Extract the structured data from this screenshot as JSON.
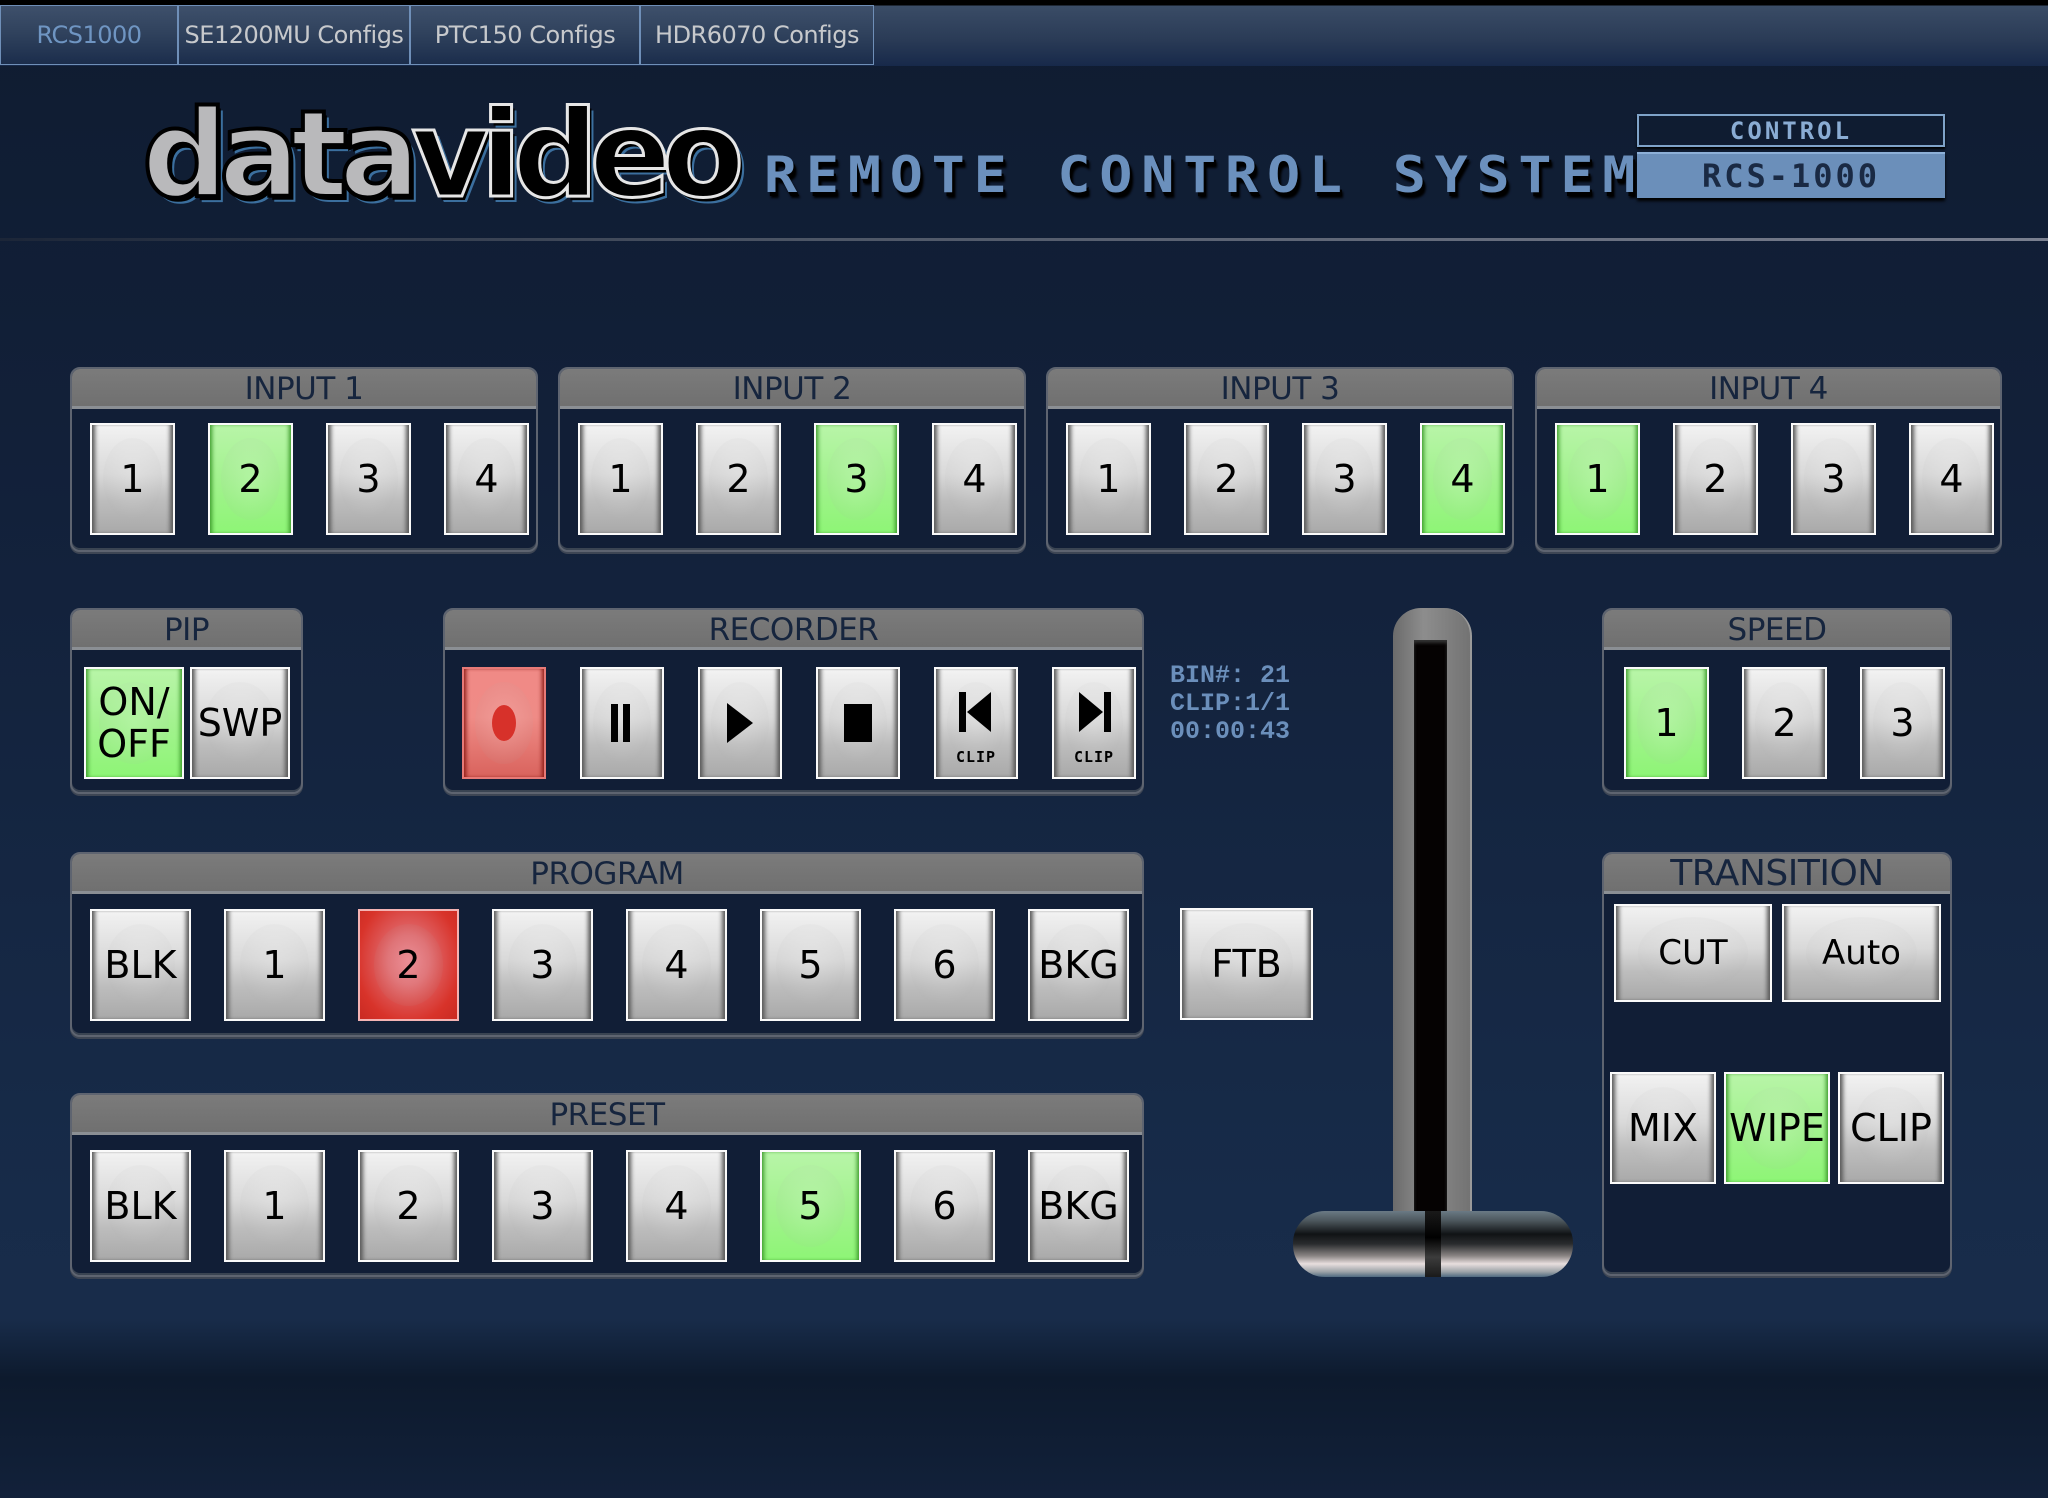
{
  "tabs": [
    {
      "label": "RCS1000",
      "active": true
    },
    {
      "label": "SE1200MU Configs",
      "active": false
    },
    {
      "label": "PTC150 Configs",
      "active": false
    },
    {
      "label": "HDR6070 Configs",
      "active": false
    }
  ],
  "header": {
    "logo_part1": "data",
    "logo_part2": "video",
    "title": "REMOTE CONTROL SYSTEM",
    "control_label": "CONTROL",
    "model": "RCS-1000"
  },
  "inputs": [
    {
      "title": "INPUT 1",
      "buttons": [
        "1",
        "2",
        "3",
        "4"
      ],
      "selected": "2"
    },
    {
      "title": "INPUT 2",
      "buttons": [
        "1",
        "2",
        "3",
        "4"
      ],
      "selected": "3"
    },
    {
      "title": "INPUT 3",
      "buttons": [
        "1",
        "2",
        "3",
        "4"
      ],
      "selected": "4"
    },
    {
      "title": "INPUT 4",
      "buttons": [
        "1",
        "2",
        "3",
        "4"
      ],
      "selected": "1"
    }
  ],
  "pip": {
    "title": "PIP",
    "onoff_line1": "ON/",
    "onoff_line2": "OFF",
    "onoff_active": true,
    "swap": "SWP"
  },
  "recorder": {
    "title": "RECORDER",
    "buttons": [
      "record-icon",
      "pause-icon",
      "play-icon",
      "stop-icon",
      "prev-clip-icon",
      "next-clip-icon"
    ],
    "clip_label": "CLIP",
    "recording": true,
    "bin": "BIN#: 21",
    "clip": "CLIP:1/1",
    "time": "00:00:43"
  },
  "speed": {
    "title": "SPEED",
    "buttons": [
      "1",
      "2",
      "3"
    ],
    "selected": "1"
  },
  "transition": {
    "title": "TRANSITION",
    "cut": "CUT",
    "auto": "Auto",
    "types": [
      "MIX",
      "WIPE",
      "CLIP"
    ],
    "selected_type": "WIPE"
  },
  "program": {
    "title": "PROGRAM",
    "buttons": [
      "BLK",
      "1",
      "2",
      "3",
      "4",
      "5",
      "6",
      "BKG"
    ],
    "selected": "2"
  },
  "ftb": "FTB",
  "preset": {
    "title": "PRESET",
    "buttons": [
      "BLK",
      "1",
      "2",
      "3",
      "4",
      "5",
      "6",
      "BKG"
    ],
    "selected": "5"
  },
  "tbar": {
    "position_percent": 100
  },
  "colors": {
    "selected_green": "#a3f28f",
    "program_red": "#d8332a",
    "accent_blue": "#6b8fbb",
    "background": "#122039"
  }
}
